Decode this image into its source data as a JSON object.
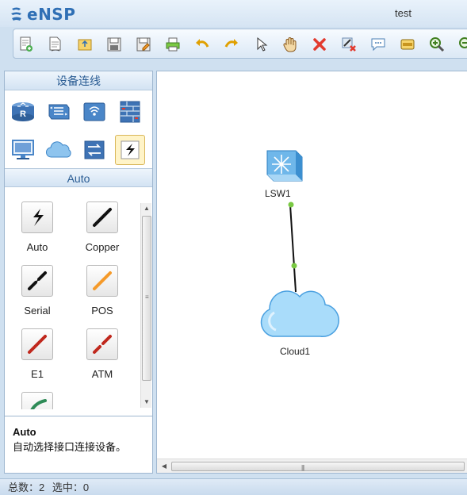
{
  "app": {
    "name": "eNSP",
    "window_title": "test"
  },
  "toolbar": {
    "icons": [
      "new-topology-icon",
      "new-file-icon",
      "open-icon",
      "save-icon",
      "save-as-icon",
      "print-icon",
      "undo-icon",
      "redo-icon",
      "select-pointer-icon",
      "pan-hand-icon",
      "delete-icon",
      "delete-link-icon",
      "text-annotation-icon",
      "rectangle-icon",
      "zoom-in-icon",
      "zoom-out-icon"
    ]
  },
  "left_panel": {
    "device_header": "设备连线",
    "device_categories": [
      {
        "icon": "router-icon",
        "selected": false
      },
      {
        "icon": "switch-icon",
        "selected": false
      },
      {
        "icon": "wireless-icon",
        "selected": false
      },
      {
        "icon": "firewall-icon",
        "selected": false
      },
      {
        "icon": "pc-terminal-icon",
        "selected": false
      },
      {
        "icon": "cloud-icon",
        "selected": false
      },
      {
        "icon": "other-device-icon",
        "selected": false
      },
      {
        "icon": "cable-icon",
        "selected": true
      }
    ],
    "cable_header": "Auto",
    "cables": [
      {
        "label": "Auto",
        "color": "#111111",
        "style": "lightning"
      },
      {
        "label": "Copper",
        "color": "#111111",
        "style": "solid"
      },
      {
        "label": "Serial",
        "color": "#111111",
        "style": "serial"
      },
      {
        "label": "POS",
        "color": "#f59a2a",
        "style": "solid"
      },
      {
        "label": "E1",
        "color": "#c0281d",
        "style": "solid"
      },
      {
        "label": "ATM",
        "color": "#c0281d",
        "style": "dashed"
      },
      {
        "label": "",
        "color": "#2e8b57",
        "style": "curve"
      }
    ],
    "description": {
      "title": "Auto",
      "text": "自动选择接口连接设备。"
    }
  },
  "canvas": {
    "nodes": [
      {
        "label": "LSW1",
        "type": "switch"
      },
      {
        "label": "Cloud1",
        "type": "cloud"
      }
    ],
    "link_color": "#111111",
    "port_color": "#7ac943"
  },
  "status_bar": {
    "total_label": "总数：2",
    "selected_label": "选中：0"
  },
  "colors": {
    "accent": "#2f6fb5",
    "panel_header_text": "#2a5c93",
    "selection_bg": "#fff4c8"
  }
}
